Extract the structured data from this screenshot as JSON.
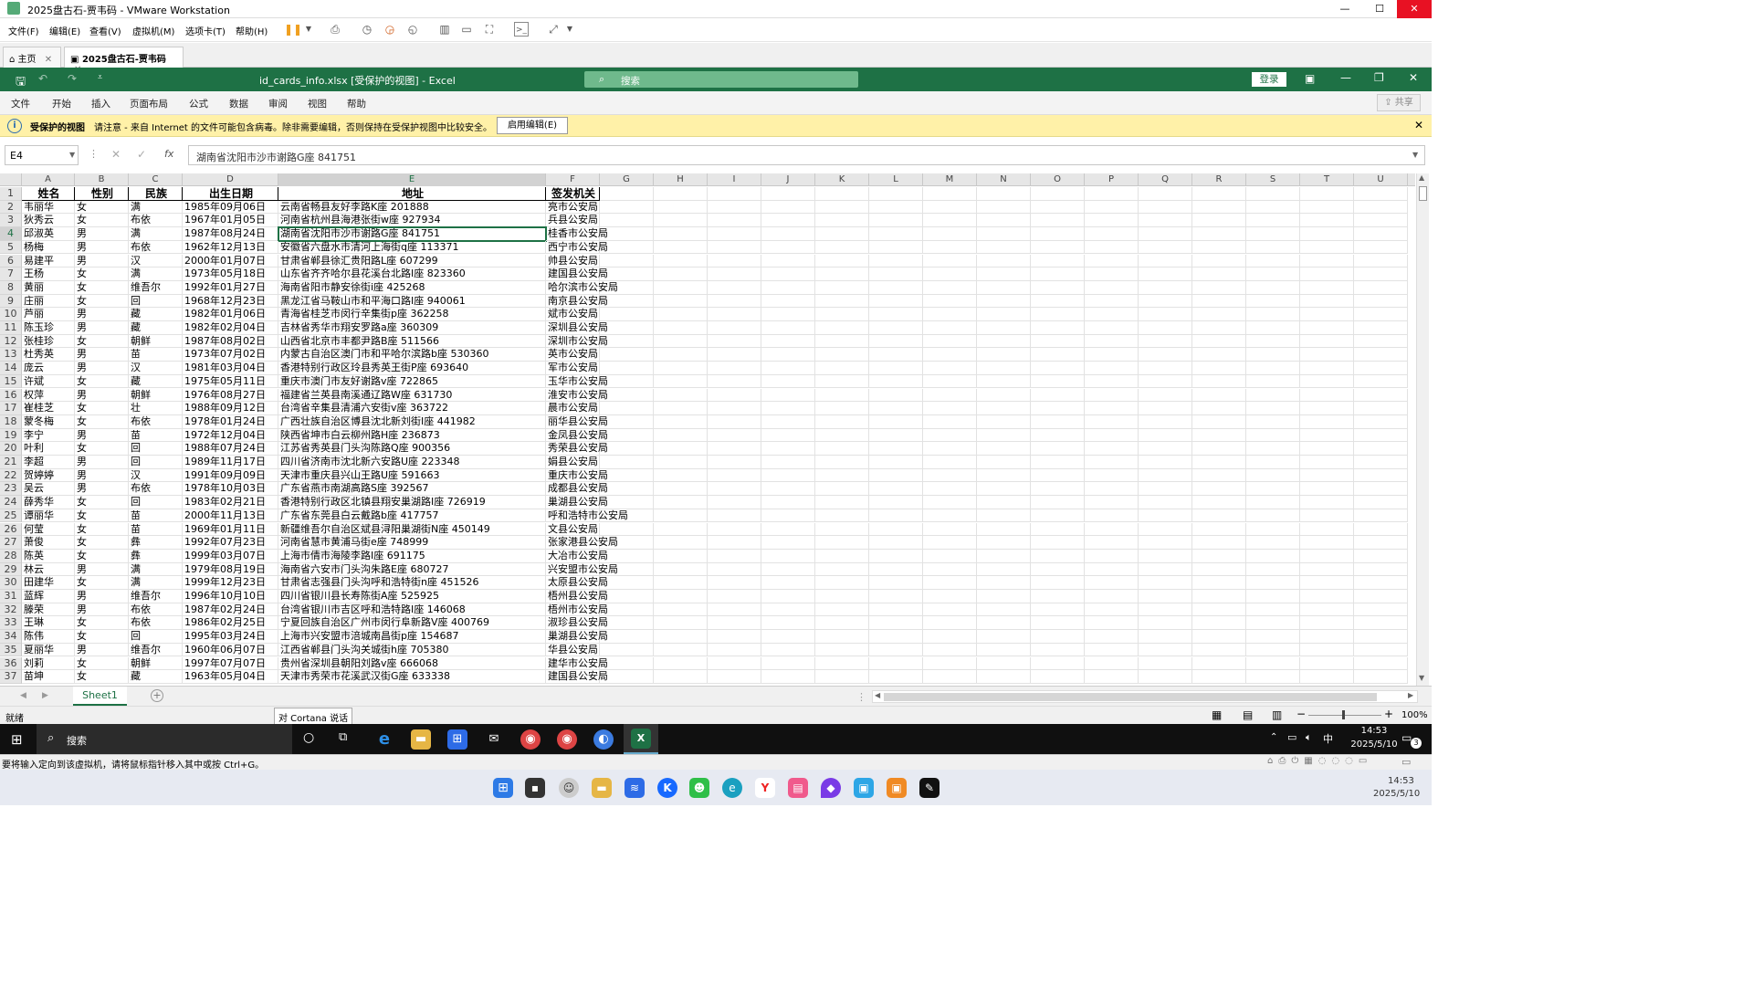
{
  "vm": {
    "title": "2025盘古石-贾韦码 - VMware Workstation",
    "menu": [
      "文件(F)",
      "编辑(E)",
      "查看(V)",
      "虚拟机(M)",
      "选项卡(T)",
      "帮助(H)"
    ],
    "tabs": [
      "主页",
      "2025盘古石-贾韦码"
    ],
    "status_hint": "要将输入定向到该虚拟机，请将鼠标指针移入其中或按 Ctrl+G。"
  },
  "excel": {
    "file_title": "id_cards_info.xlsx  [受保护的视图]  -  Excel",
    "search_placeholder": "搜索",
    "login": "登录",
    "ribbon_tabs": [
      "文件",
      "开始",
      "插入",
      "页面布局",
      "公式",
      "数据",
      "审阅",
      "视图",
      "帮助"
    ],
    "share": "共享",
    "protected": {
      "label": "受保护的视图",
      "message": "请注意 - 来自 Internet 的文件可能包含病毒。除非需要编辑，否则保持在受保护视图中比较安全。",
      "button": "启用编辑(E)"
    },
    "name_box": "E4",
    "formula": "湖南省沈阳市沙市谢路G座 841751",
    "fx": "fx",
    "columns": [
      "A",
      "B",
      "C",
      "D",
      "E",
      "F",
      "G",
      "H",
      "I",
      "J",
      "K",
      "L",
      "M",
      "N",
      "O",
      "P",
      "Q",
      "R",
      "S",
      "T",
      "U"
    ],
    "headers": [
      "姓名",
      "性别",
      "民族",
      "出生日期",
      "地址",
      "签发机关"
    ],
    "rows": [
      [
        "韦丽华",
        "女",
        "满",
        "1985年09月06日",
        "云南省畅县友好李路K座 201888",
        "亮市公安局"
      ],
      [
        "狄秀云",
        "女",
        "布依",
        "1967年01月05日",
        "河南省杭州县海港张街w座 927934",
        "兵县公安局"
      ],
      [
        "邱淑英",
        "男",
        "满",
        "1987年08月24日",
        "湖南省沈阳市沙市谢路G座 841751",
        "桂香市公安局"
      ],
      [
        "杨梅",
        "男",
        "布依",
        "1962年12月13日",
        "安徽省六盘水市清河上海街q座 113371",
        "西宁市公安局"
      ],
      [
        "易建平",
        "男",
        "汉",
        "2000年01月07日",
        "甘肃省郸县徐汇贵阳路L座 607299",
        "帅县公安局"
      ],
      [
        "王杨",
        "女",
        "满",
        "1973年05月18日",
        "山东省齐齐哈尔县花溪台北路I座 823360",
        "建国县公安局"
      ],
      [
        "黄丽",
        "女",
        "维吾尔",
        "1992年01月27日",
        "海南省阳市静安徐街i座 425268",
        "哈尔滨市公安局"
      ],
      [
        "庄丽",
        "女",
        "回",
        "1968年12月23日",
        "黑龙江省马鞍山市和平海口路I座 940061",
        "南京县公安局"
      ],
      [
        "芦丽",
        "男",
        "藏",
        "1982年01月06日",
        "青海省桂芝市闵行辛集街p座 362258",
        "斌市公安局"
      ],
      [
        "陈玉珍",
        "男",
        "藏",
        "1982年02月04日",
        "吉林省秀华市翔安罗路a座 360309",
        "深圳县公安局"
      ],
      [
        "张桂珍",
        "女",
        "朝鲜",
        "1987年08月02日",
        "山西省北京市丰都尹路B座 511566",
        "深圳市公安局"
      ],
      [
        "杜秀英",
        "男",
        "苗",
        "1973年07月02日",
        "内蒙古自治区澳门市和平哈尔滨路b座 530360",
        "英市公安局"
      ],
      [
        "庞云",
        "男",
        "汉",
        "1981年03月04日",
        "香港特别行政区玲县秀英王街P座 693640",
        "军市公安局"
      ],
      [
        "许斌",
        "女",
        "藏",
        "1975年05月11日",
        "重庆市澳门市友好谢路v座 722865",
        "玉华市公安局"
      ],
      [
        "权萍",
        "男",
        "朝鲜",
        "1976年08月27日",
        "福建省兰英县南溪通辽路W座 631730",
        "淮安市公安局"
      ],
      [
        "崔桂芝",
        "女",
        "壮",
        "1988年09月12日",
        "台湾省辛集县清浦六安街v座 363722",
        "晨市公安局"
      ],
      [
        "蒙冬梅",
        "女",
        "布依",
        "1978年01月24日",
        "广西壮族自治区博县沈北新刘街I座 441982",
        "丽华县公安局"
      ],
      [
        "李宁",
        "男",
        "苗",
        "1972年12月04日",
        "陕西省坤市白云柳州路H座 236873",
        "金凤县公安局"
      ],
      [
        "叶利",
        "女",
        "回",
        "1988年07月24日",
        "江苏省秀英县门头沟陈路Q座 900356",
        "秀荣县公安局"
      ],
      [
        "李超",
        "男",
        "回",
        "1989年11月17日",
        "四川省济南市沈北新六安路U座 223348",
        "娟县公安局"
      ],
      [
        "贺婷婷",
        "男",
        "汉",
        "1991年09月09日",
        "天津市重庆县兴山王路U座 591663",
        "重庆市公安局"
      ],
      [
        "吴云",
        "男",
        "布依",
        "1978年10月03日",
        "广东省燕市南湖高路S座 392567",
        "成都县公安局"
      ],
      [
        "薛秀华",
        "女",
        "回",
        "1983年02月21日",
        "香港特别行政区北镇县翔安巢湖路I座 726919",
        "巢湖县公安局"
      ],
      [
        "谭丽华",
        "女",
        "苗",
        "2000年11月13日",
        "广东省东莞县白云戴路b座 417757",
        "呼和浩特市公安局"
      ],
      [
        "何莹",
        "女",
        "苗",
        "1969年01月11日",
        "新疆维吾尔自治区斌县浔阳巢湖街N座 450149",
        "文县公安局"
      ],
      [
        "萧俊",
        "女",
        "彝",
        "1992年07月23日",
        "河南省慧市黄浦马街e座 748999",
        "张家港县公安局"
      ],
      [
        "陈英",
        "女",
        "彝",
        "1999年03月07日",
        "上海市倩市海陵李路I座 691175",
        "大冶市公安局"
      ],
      [
        "林云",
        "男",
        "满",
        "1979年08月19日",
        "海南省六安市门头沟朱路E座 680727",
        "兴安盟市公安局"
      ],
      [
        "田建华",
        "女",
        "满",
        "1999年12月23日",
        "甘肃省志强县门头沟呼和浩特街n座 451526",
        "太原县公安局"
      ],
      [
        "蓝辉",
        "男",
        "维吾尔",
        "1996年10月10日",
        "四川省银川县长寿陈街A座 525925",
        "梧州县公安局"
      ],
      [
        "滕荣",
        "男",
        "布依",
        "1987年02月24日",
        "台湾省银川市吉区呼和浩特路I座 146068",
        "梧州市公安局"
      ],
      [
        "王琳",
        "女",
        "布依",
        "1986年02月25日",
        "宁夏回族自治区广州市闵行阜新路V座 400769",
        "淑珍县公安局"
      ],
      [
        "陈伟",
        "女",
        "回",
        "1995年03月24日",
        "上海市兴安盟市涪城南昌街p座 154687",
        "巢湖县公安局"
      ],
      [
        "夏丽华",
        "男",
        "维吾尔",
        "1960年06月07日",
        "江西省郸县门头沟关城街h座 705380",
        "华县公安局"
      ],
      [
        "刘莉",
        "女",
        "朝鲜",
        "1997年07月07日",
        "贵州省深圳县朝阳刘路v座 666068",
        "建华市公安局"
      ],
      [
        "苗坤",
        "女",
        "藏",
        "1963年05月04日",
        "天津市秀荣市花溪武汉街G座 633338",
        "建国县公安局"
      ]
    ],
    "sheet_tab": "Sheet1",
    "status": "就绪",
    "cortana_tip": "对 Cortana 说话",
    "zoom": "100%"
  },
  "guest_taskbar": {
    "search": "搜索",
    "time": "14:53",
    "date": "2025/5/10",
    "ime": "中",
    "notif_count": "3"
  },
  "host_clock": {
    "time": "14:53",
    "date": "2025/5/10"
  }
}
